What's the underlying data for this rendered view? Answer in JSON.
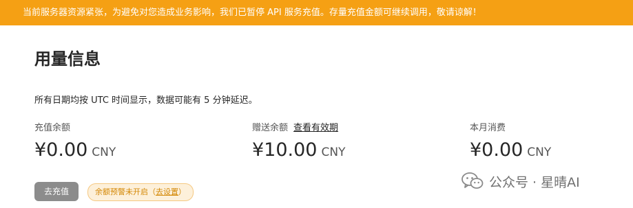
{
  "banner": {
    "text": "当前服务器资源紧张，为避免对您造成业务影响，我们已暂停 API 服务充值。存量充值金额可继续调用，敬请谅解！"
  },
  "page": {
    "title": "用量信息",
    "note": "所有日期均按 UTC 时间显示，数据可能有 5 分钟延迟。"
  },
  "stats": {
    "recharge_balance": {
      "label": "充值余额",
      "amount": "¥0.00",
      "unit": "CNY"
    },
    "gift_balance": {
      "label": "赠送余额",
      "link": "查看有效期",
      "amount": "¥10.00",
      "unit": "CNY"
    },
    "monthly_spend": {
      "label": "本月消费",
      "amount": "¥0.00",
      "unit": "CNY"
    }
  },
  "actions": {
    "recharge_label": "去充值",
    "alert_text": "余额预警未开启",
    "alert_open": "（",
    "alert_link": "去设置",
    "alert_close": "）"
  },
  "watermark": {
    "text": "公众号 · 星晴AI",
    "icon": "wechat-icon"
  },
  "colors": {
    "banner_bg": "#f5a014",
    "button_bg": "#8c8c8c",
    "pill_bg": "#fdf0da",
    "pill_text": "#d48806"
  }
}
